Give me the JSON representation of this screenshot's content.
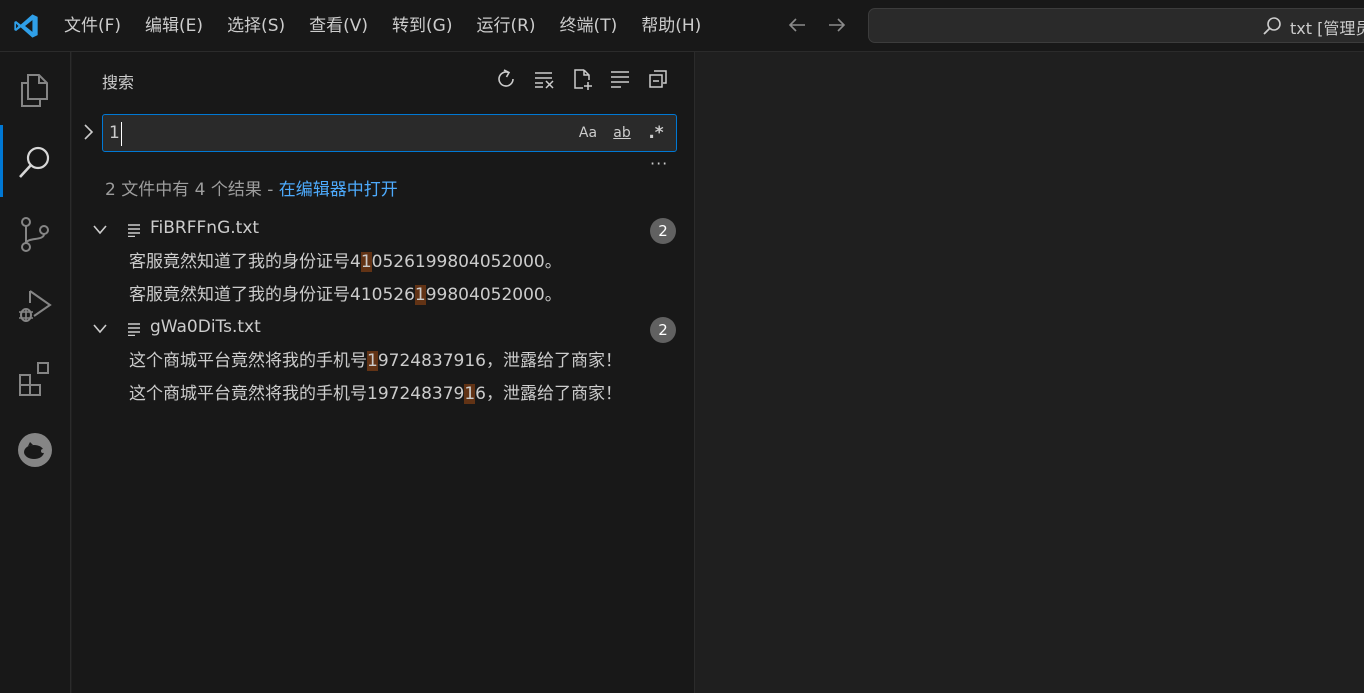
{
  "menu": [
    "文件(F)",
    "编辑(E)",
    "选择(S)",
    "查看(V)",
    "转到(G)",
    "运行(R)",
    "终端(T)",
    "帮助(H)"
  ],
  "command_center": {
    "text": "txt [管理员]"
  },
  "colors": {
    "accent": "#0078d4",
    "link": "#4daafc",
    "match_highlight": "#623315",
    "badge": "#616161"
  },
  "activity_bar": {
    "items": [
      "explorer-icon",
      "search-icon",
      "source-control-icon",
      "run-debug-icon",
      "extensions-icon",
      "piggy-icon"
    ],
    "active": "search-icon"
  },
  "sidebar": {
    "title": "搜索",
    "actions": [
      "refresh-icon",
      "clear-results-icon",
      "new-search-editor-icon",
      "view-as-tree-icon",
      "collapse-all-icon"
    ],
    "search": {
      "value": "1",
      "options": {
        "match_case": "Aa",
        "whole_word": "ab",
        "regex": ".*"
      }
    },
    "more": "···",
    "summary": {
      "text": "2 文件中有 4 个结果 - ",
      "link": "在编辑器中打开"
    },
    "results": [
      {
        "file": "FiBRFFnG.txt",
        "count": "2",
        "matches": [
          {
            "before": "客服竟然知道了我的身份证号4",
            "match": "1",
            "after": "0526199804052000。"
          },
          {
            "before": "客服竟然知道了我的身份证号410526",
            "match": "1",
            "after": "99804052000。"
          }
        ]
      },
      {
        "file": "gWa0DiTs.txt",
        "count": "2",
        "matches": [
          {
            "before": "这个商城平台竟然将我的手机号",
            "match": "1",
            "after": "9724837916，泄露给了商家！"
          },
          {
            "before": "这个商城平台竟然将我的手机号197248379",
            "match": "1",
            "after": "6，泄露给了商家！"
          }
        ]
      }
    ]
  }
}
